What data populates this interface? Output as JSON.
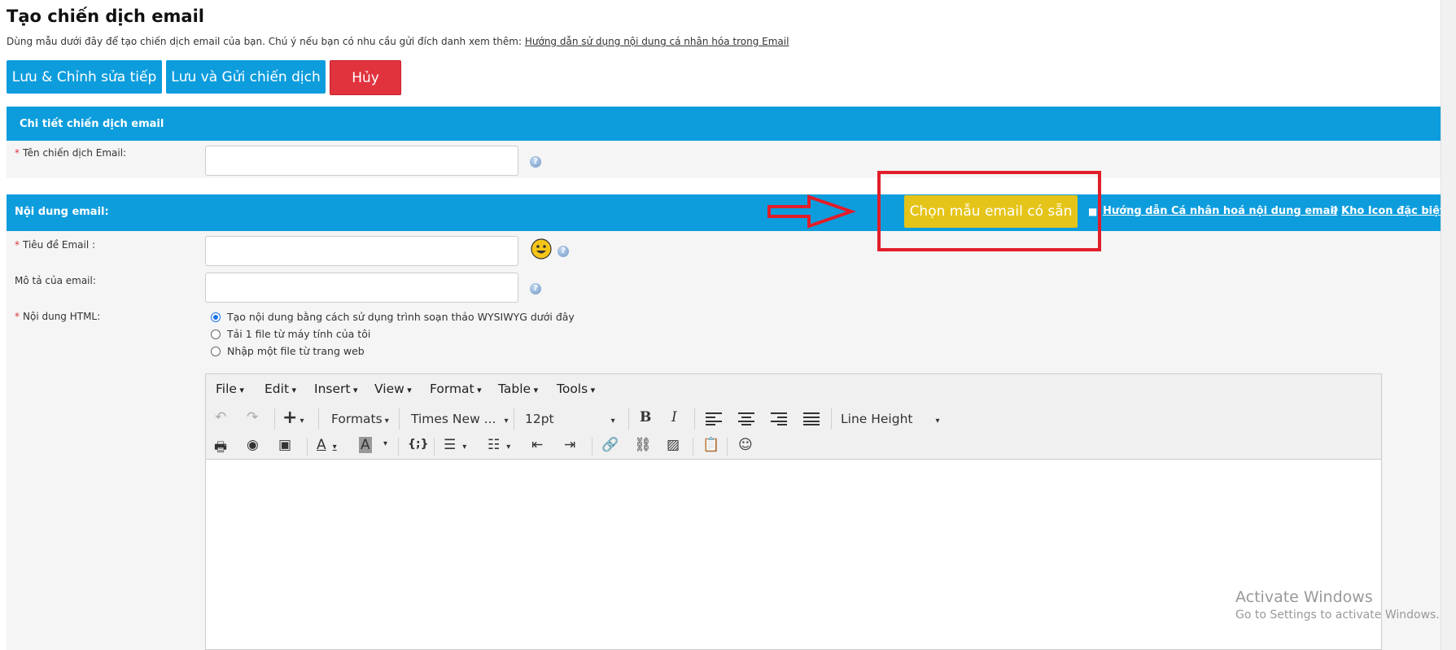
{
  "header": {
    "title": "Tạo chiến dịch email",
    "description": "Dùng mẫu dưới đây để tạo chiến dịch email của bạn. Chú ý nếu bạn có nhu cầu gửi đích danh xem thêm:",
    "description_link": "Hướng dẫn sử dụng nội dung cá nhân hóa trong Email"
  },
  "actions": {
    "save_continue": "Lưu & Chỉnh sửa tiếp",
    "save_send": "Lưu và Gửi chiến dịch",
    "cancel": "Hủy"
  },
  "campaign_details": {
    "heading": "Chi tiết chiến dịch email",
    "name_label": "Tên chiến dịch Email:",
    "name_value": ""
  },
  "email_content": {
    "heading": "Nội dung email:",
    "template_button": "Chọn mẫu email có sẵn",
    "guide_link": "Hướng dẫn Cá nhân hoá nội dung email",
    "icon_store_link": "Kho Icon đặc biệt",
    "subject_label": "Tiêu đề Email :",
    "subject_value": "",
    "description_label": "Mô tả của email:",
    "description_value": "",
    "html_label": "Nội dung HTML:",
    "html_options": [
      "Tạo nội dung bằng cách sử dụng trình soạn thảo WYSIWYG dưới đây",
      "Tải 1 file từ máy tính của tôi",
      "Nhập một file từ trang web"
    ],
    "html_selected_index": 0
  },
  "editor": {
    "menus": [
      "File",
      "Edit",
      "Insert",
      "View",
      "Format",
      "Table",
      "Tools"
    ],
    "formats_label": "Formats",
    "font_family": "Times New ...",
    "font_size": "12pt",
    "line_height_label": "Line Height",
    "icons": [
      "undo-icon",
      "redo-icon",
      "insert-icon",
      "bold-icon",
      "italic-icon",
      "align-left-icon",
      "align-center-icon",
      "align-right-icon",
      "justify-icon",
      "print-icon",
      "preview-icon",
      "media-icon",
      "text-color-icon",
      "background-color-icon",
      "code-icon",
      "bullet-list-icon",
      "numbered-list-icon",
      "outdent-icon",
      "indent-icon",
      "link-icon",
      "unlink-icon",
      "image-icon",
      "paste-icon",
      "emoticon-icon"
    ]
  },
  "watermark": {
    "title": "Activate Windows",
    "subtitle": "Go to Settings to activate Windows."
  },
  "colors": {
    "primary": "#0d9ddd",
    "danger": "#e0333e",
    "warning": "#e5c419",
    "annotation": "#e11d2a"
  }
}
